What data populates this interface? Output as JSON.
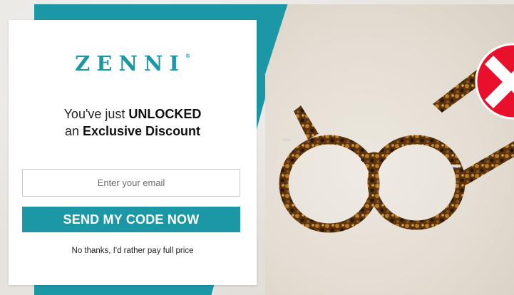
{
  "brand": {
    "logo_text": "ZENNI",
    "trademark": "®",
    "accent_color": "#1b97a5",
    "close_color": "#e8102a"
  },
  "popup": {
    "headline_prefix": "You've just ",
    "headline_unlocked": "UNLOCKED",
    "headline_line2_prefix": "an ",
    "headline_line2_bold": "Exclusive Discount",
    "email_placeholder": "Enter your email",
    "email_value": "",
    "cta_label": "SEND MY CODE NOW",
    "decline_label": "No thanks, I'd rather pay full price"
  },
  "icons": {
    "close": "close-x-icon",
    "hero": "tortoiseshell-glasses-image"
  }
}
